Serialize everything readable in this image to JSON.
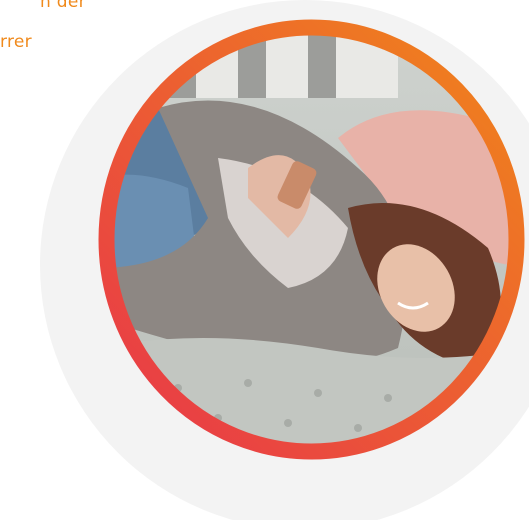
{
  "text_fragments": {
    "line1": "n der",
    "line2": "rrer"
  },
  "colors": {
    "ring_start": "#e8364a",
    "ring_end": "#f0861a",
    "accent_text": "#f08a1c",
    "backdrop": "#f3f3f3"
  },
  "image": {
    "description_icon": "woman-on-sofa-photo"
  }
}
